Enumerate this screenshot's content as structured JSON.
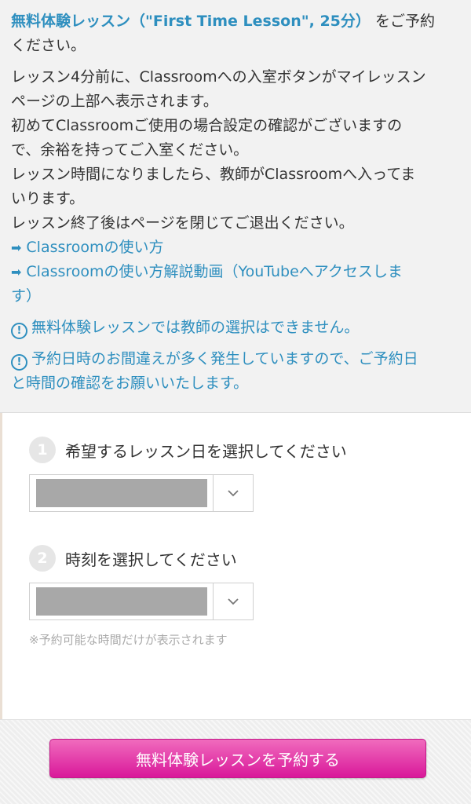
{
  "intro": {
    "highlight": "無料体験レッスン（\"First Time Lesson\", 25分）",
    "highlight_suffix": "をご予約",
    "line2": "ください。"
  },
  "paragraph": {
    "line1": "レッスン4分前に、Classroomへの入室ボタンがマイレッスン",
    "line2": "ページの上部へ表示されます。",
    "line3": "初めてClassroomご使用の場合設定の確認がございますの",
    "line4": "で、余裕を持ってご入室ください。",
    "line5": "レッスン時間になりましたら、教師がClassroomへ入ってま",
    "line6": "いります。",
    "line7": "レッスン終了後はページを閉じてご退出ください。"
  },
  "links": {
    "usage": "Classroomの使い方",
    "video_line1": "Classroomの使い方解説動画（YouTubeへアクセスしま",
    "video_line2": "す）"
  },
  "warnings": {
    "no_teacher_select": "無料体験レッスンでは教師の選択はできません。",
    "check_line1": "予約日時のお間違えが多く発生していますので、ご予約日",
    "check_line2": "と時間の確認をお願いいたします。"
  },
  "form": {
    "step1": {
      "number": "1",
      "label": "希望するレッスン日を選択してください"
    },
    "step2": {
      "number": "2",
      "label": "時刻を選択してください"
    },
    "note": "※予約可能な時間だけが表示されます"
  },
  "cta": {
    "label": "無料体験レッスンを予約する"
  },
  "colors": {
    "link": "#2e8fbf",
    "cta": "#e33aa9"
  },
  "icons": {
    "arrow": "arrow-right-icon",
    "warning": "exclamation-circle-icon",
    "chevron": "chevron-down-icon"
  }
}
